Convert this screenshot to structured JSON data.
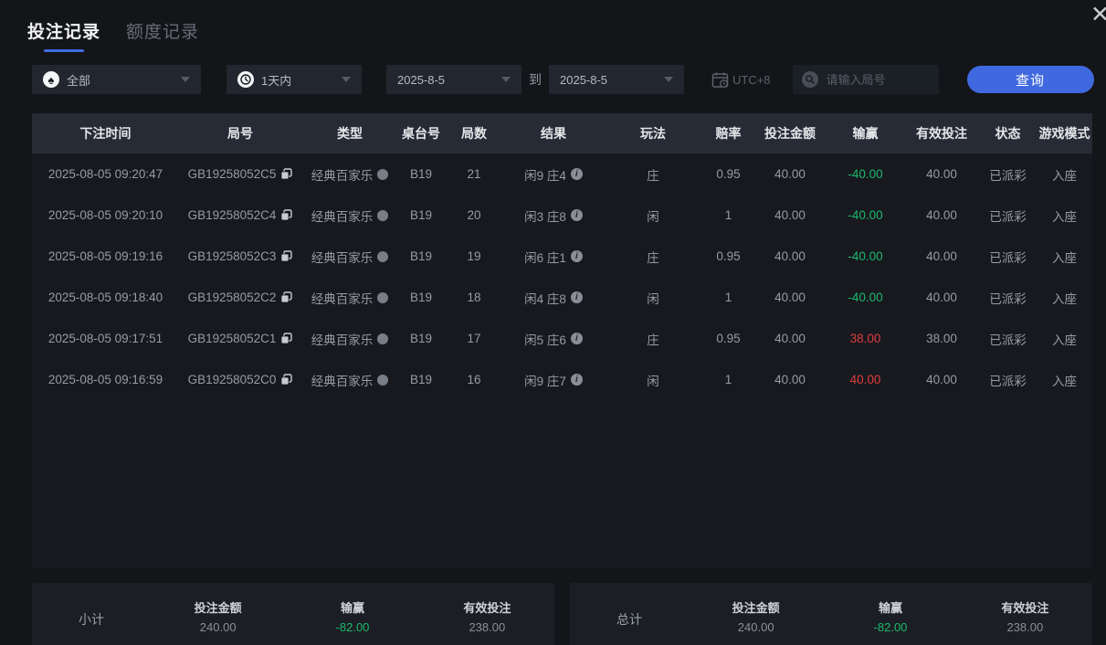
{
  "window": {
    "close_glyph": "✕"
  },
  "tabs": [
    {
      "label": "投注记录",
      "active": true
    },
    {
      "label": "额度记录",
      "active": false
    }
  ],
  "filters": {
    "game_type": {
      "value": "全部",
      "icon": "spade-icon",
      "icon_glyph": "♠"
    },
    "time_range": {
      "value": "1天内",
      "icon": "clock-icon"
    },
    "date_from": "2025-8-5",
    "to_label": "到",
    "date_to": "2025-8-5",
    "timezone": {
      "icon": "calendar-icon",
      "label": "UTC+8"
    },
    "search": {
      "icon": "search-icon",
      "placeholder": "请输入局号"
    },
    "query_button": "查询"
  },
  "table": {
    "columns": [
      "下注时间",
      "局号",
      "类型",
      "桌台号",
      "局数",
      "结果",
      "玩法",
      "赔率",
      "投注金额",
      "输赢",
      "有效投注",
      "状态",
      "游戏模式"
    ],
    "info_glyph": "i",
    "rows": [
      {
        "time": "2025-08-05 09:20:47",
        "game_id": "GB19258052C5",
        "type": "经典百家乐",
        "table_no": "B19",
        "round": "21",
        "result": "闲9 庄4",
        "play": "庄",
        "odds": "0.95",
        "bet": "40.00",
        "win_loss": "-40.00",
        "win_loss_color": "green",
        "valid_bet": "40.00",
        "status": "已派彩",
        "mode": "入座"
      },
      {
        "time": "2025-08-05 09:20:10",
        "game_id": "GB19258052C4",
        "type": "经典百家乐",
        "table_no": "B19",
        "round": "20",
        "result": "闲3 庄8",
        "play": "闲",
        "odds": "1",
        "bet": "40.00",
        "win_loss": "-40.00",
        "win_loss_color": "green",
        "valid_bet": "40.00",
        "status": "已派彩",
        "mode": "入座"
      },
      {
        "time": "2025-08-05 09:19:16",
        "game_id": "GB19258052C3",
        "type": "经典百家乐",
        "table_no": "B19",
        "round": "19",
        "result": "闲6 庄1",
        "play": "庄",
        "odds": "0.95",
        "bet": "40.00",
        "win_loss": "-40.00",
        "win_loss_color": "green",
        "valid_bet": "40.00",
        "status": "已派彩",
        "mode": "入座"
      },
      {
        "time": "2025-08-05 09:18:40",
        "game_id": "GB19258052C2",
        "type": "经典百家乐",
        "table_no": "B19",
        "round": "18",
        "result": "闲4 庄8",
        "play": "闲",
        "odds": "1",
        "bet": "40.00",
        "win_loss": "-40.00",
        "win_loss_color": "green",
        "valid_bet": "40.00",
        "status": "已派彩",
        "mode": "入座"
      },
      {
        "time": "2025-08-05 09:17:51",
        "game_id": "GB19258052C1",
        "type": "经典百家乐",
        "table_no": "B19",
        "round": "17",
        "result": "闲5 庄6",
        "play": "庄",
        "odds": "0.95",
        "bet": "40.00",
        "win_loss": "38.00",
        "win_loss_color": "red",
        "valid_bet": "38.00",
        "status": "已派彩",
        "mode": "入座"
      },
      {
        "time": "2025-08-05 09:16:59",
        "game_id": "GB19258052C0",
        "type": "经典百家乐",
        "table_no": "B19",
        "round": "16",
        "result": "闲9 庄7",
        "play": "闲",
        "odds": "1",
        "bet": "40.00",
        "win_loss": "40.00",
        "win_loss_color": "red",
        "valid_bet": "40.00",
        "status": "已派彩",
        "mode": "入座"
      }
    ]
  },
  "summary": {
    "subtotal": {
      "label": "小计",
      "bet_label": "投注金额",
      "bet_value": "240.00",
      "win_label": "输赢",
      "win_value": "-82.00",
      "valid_label": "有效投注",
      "valid_value": "238.00"
    },
    "total": {
      "label": "总计",
      "bet_label": "投注金额",
      "bet_value": "240.00",
      "win_label": "输赢",
      "win_value": "-82.00",
      "valid_label": "有效投注",
      "valid_value": "238.00"
    }
  },
  "colors": {
    "accent_blue": "#4169df",
    "tab_underline": "#3f6ce0",
    "loss_green": "#1db96c",
    "win_red": "#e03e3e",
    "header_bg": "#262b36",
    "table_bg": "#17191f",
    "page_bg": "#141519"
  }
}
